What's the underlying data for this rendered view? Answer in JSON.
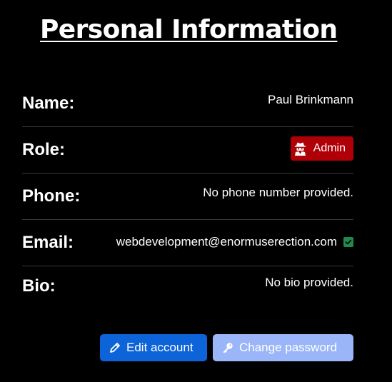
{
  "page": {
    "title": "Personal Information"
  },
  "fields": {
    "name": {
      "label": "Name:",
      "value": "Paul Brinkmann"
    },
    "role": {
      "label": "Role:",
      "value": "Admin",
      "badge_color": "#b00007",
      "icon": "user-secret-icon"
    },
    "phone": {
      "label": "Phone:",
      "value": "No phone number provided."
    },
    "email": {
      "label": "Email:",
      "value": "webdevelopment@enormuserection.com",
      "verified_icon": "check-square-icon",
      "verified_color": "#1f8a4c"
    },
    "bio": {
      "label": "Bio:",
      "value": "No bio provided."
    }
  },
  "actions": {
    "edit": {
      "label": "Edit account",
      "icon": "pencil-icon",
      "color": "#0d63d8"
    },
    "change_password": {
      "label": "Change password",
      "icon": "key-icon",
      "color": "#9bb6f8"
    }
  }
}
